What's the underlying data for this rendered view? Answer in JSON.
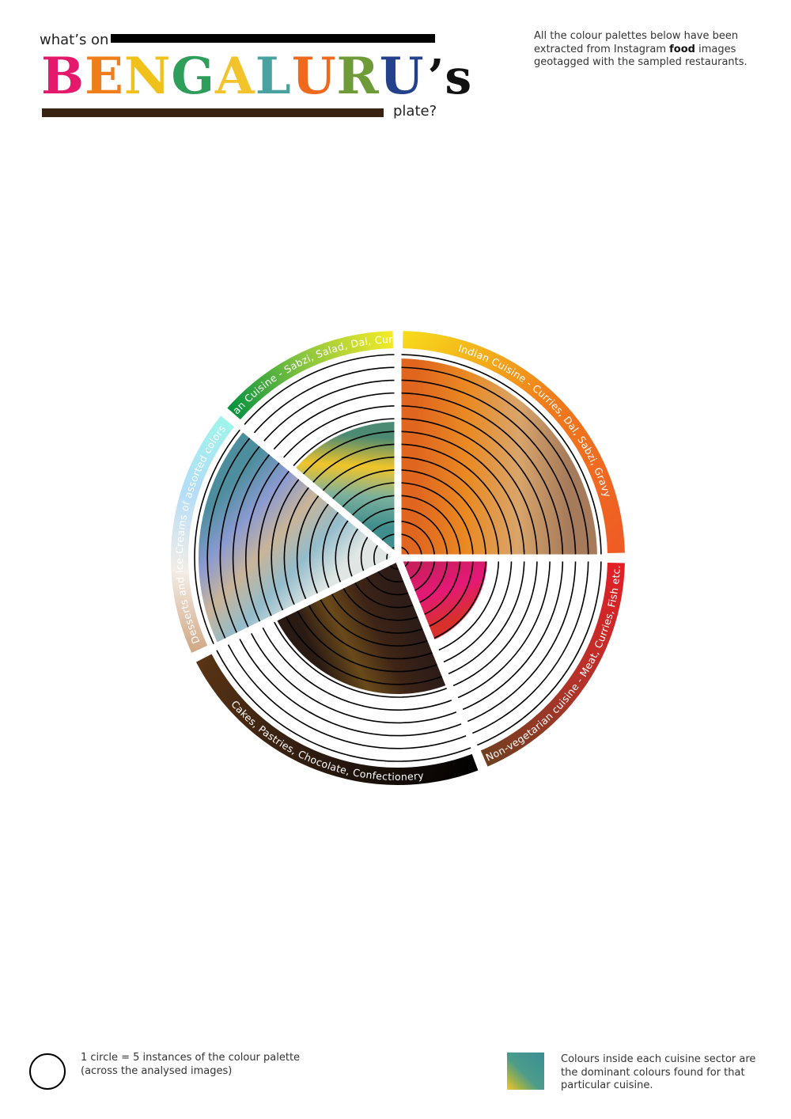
{
  "header": {
    "pretitle": "what’s on",
    "title_letters": [
      {
        "ch": "B",
        "color": "#e5196b"
      },
      {
        "ch": "E",
        "color": "#ef7d1a"
      },
      {
        "ch": "N",
        "color": "#f0c01b"
      },
      {
        "ch": "G",
        "color": "#2f9e5b"
      },
      {
        "ch": "A",
        "color": "#f2c32a"
      },
      {
        "ch": "L",
        "color": "#49a1a0"
      },
      {
        "ch": "U",
        "color": "#f06a1e"
      },
      {
        "ch": "R",
        "color": "#6e9b37"
      },
      {
        "ch": "U",
        "color": "#24418b"
      },
      {
        "ch": "’s",
        "color": "#111111"
      }
    ],
    "posttitle": "plate?",
    "note_before": "All the colour palettes below have been extracted from Instagram ",
    "note_bold": "food",
    "note_after": " images geotagged with the sampled restaurants."
  },
  "legend": {
    "circle_text": "1 circle = 5 instances of the colour palette (across the analysed images)",
    "swatch_text": "Colours inside each cuisine sector are the dominant colours found for that particular cuisine."
  },
  "chart_data": {
    "type": "radial-sector",
    "unit": "1 circle = 5 instances of the colour palette",
    "total_circles": 16,
    "sectors": [
      {
        "name": "Indian Cuisine - Curries, Dal, Sabzi, Gravy",
        "filled_circles": 13,
        "ring_colors": [
          "#f7dd1c",
          "#f07a1c",
          "#ef5a25"
        ],
        "fill_colors": [
          "#e0661f",
          "#ea8a22",
          "#d9a56a",
          "#a67b5b"
        ]
      },
      {
        "name": "Non-vegetarian cuisine - Meat, Curries, Fish etc.",
        "filled_circles": 6,
        "ring_colors": [
          "#e41e25",
          "#b5322a",
          "#6e4020"
        ],
        "fill_colors": [
          "#c91f5f",
          "#e51877",
          "#d8302b"
        ]
      },
      {
        "name": "Cakes, Pastries, Chocolate, Confectionery",
        "filled_circles": 9,
        "ring_colors": [
          "#000000",
          "#2b1a10",
          "#5a3415"
        ],
        "fill_colors": [
          "#2d1c18",
          "#3d2416",
          "#6a4a1a",
          "#2a1a14"
        ]
      },
      {
        "name": "Desserts and Ice-Creams  of  assorted colors",
        "filled_circles": 13,
        "ring_colors": [
          "#d0a682",
          "#f3ede6",
          "#b3ddf8",
          "#9ef5ea"
        ],
        "fill_colors": [
          "#dfe6e3",
          "#93bccb",
          "#c9b498",
          "#8a9ad1",
          "#4d8e9e"
        ]
      },
      {
        "name": "Vegetarian Cuisine - Sabzi, Salad, Dal, Curries etc.",
        "filled_circles": 8,
        "ring_colors": [
          "#03913f",
          "#8cc63f",
          "#f9ec27"
        ],
        "fill_colors": [
          "#3f8d8c",
          "#7bb09d",
          "#f0c52a",
          "#4d8a73"
        ]
      }
    ]
  }
}
